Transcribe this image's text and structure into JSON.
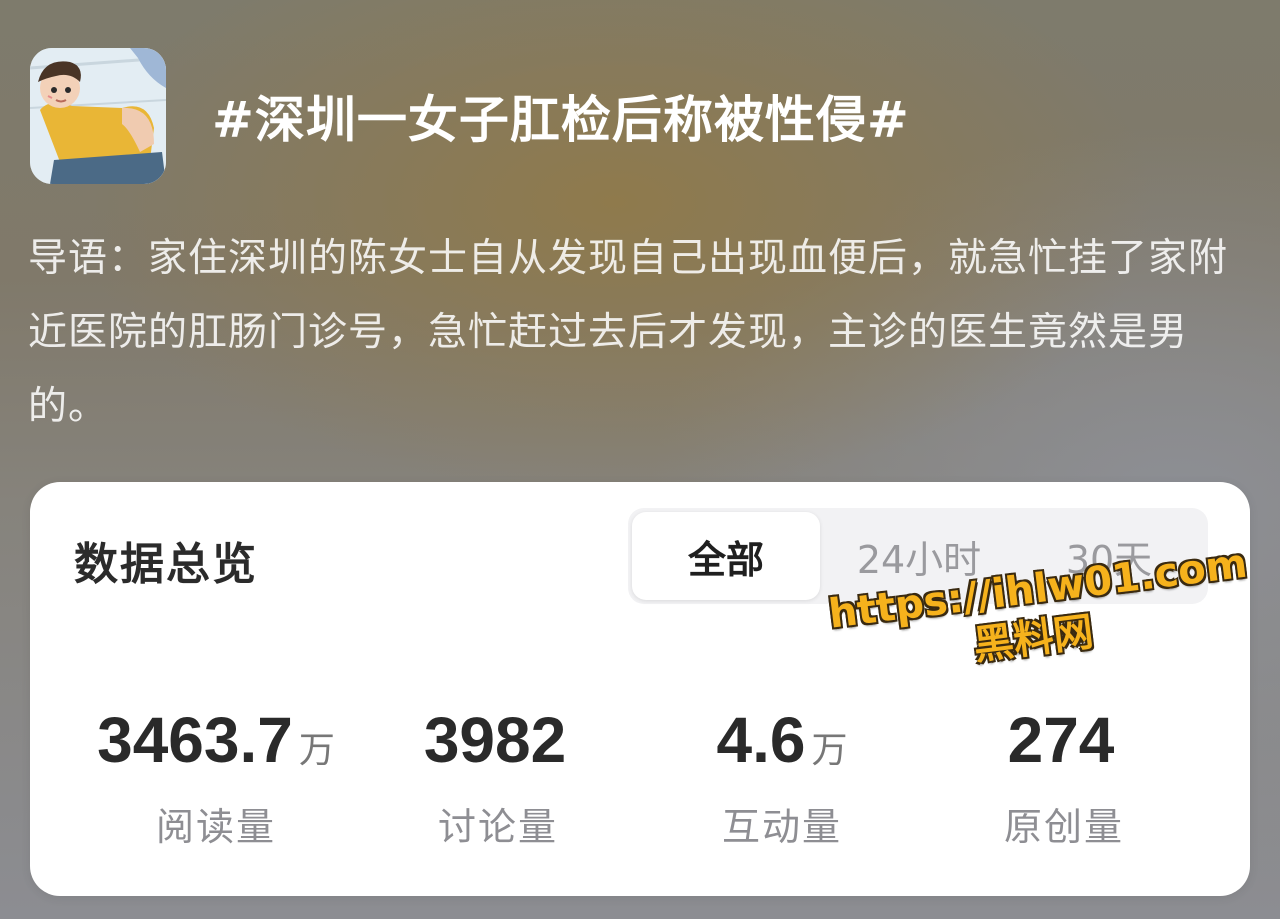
{
  "topic": {
    "title": "#深圳一女子肛检后称被性侵#",
    "intro": "导语：家住深圳的陈女士自从发现自己出现血便后，就急忙挂了家附近医院的肛肠门诊号，急忙赶过去后才发现，主诊的医生竟然是男的。"
  },
  "overview": {
    "title": "数据总览",
    "tabs": [
      {
        "label": "全部",
        "active": true
      },
      {
        "label": "24小时",
        "active": false
      },
      {
        "label": "30天",
        "active": false
      }
    ],
    "stats": [
      {
        "value": "3463.7",
        "unit": "万",
        "label": "阅读量"
      },
      {
        "value": "3982",
        "unit": "",
        "label": "讨论量"
      },
      {
        "value": "4.6",
        "unit": "万",
        "label": "互动量"
      },
      {
        "value": "274",
        "unit": "",
        "label": "原创量"
      }
    ]
  },
  "watermark": {
    "url": "https://ihlw01.com",
    "name": "黑料网"
  },
  "icons": {
    "avatar": "cartoon-avatar-icon"
  },
  "colors": {
    "watermark": "#f6b21c",
    "card_background": "#ffffff"
  }
}
